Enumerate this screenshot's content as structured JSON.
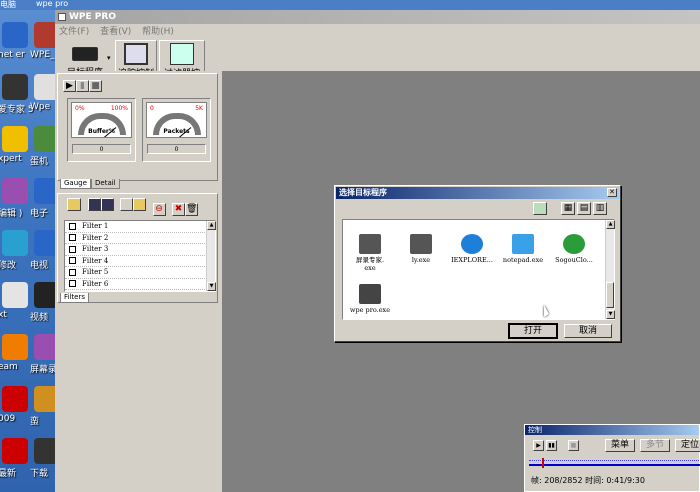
{
  "desktop": {
    "top_labels": [
      "电脑",
      "wpe pro"
    ],
    "icons": [
      {
        "label": "net er",
        "color": "#2a66c8"
      },
      {
        "label": "WPE_PI",
        "color": "#b03a2e"
      },
      {
        "label": "爱专家 5",
        "color": "#333"
      },
      {
        "label": "Wpe",
        "color": "#e0e0e0"
      },
      {
        "label": "xpert",
        "color": "#f0c000"
      },
      {
        "label": "蛋机",
        "color": "#4b8b3b"
      },
      {
        "label": "编辑 )",
        "color": "#9a4fb0"
      },
      {
        "label": "电子",
        "color": "#2a66c8"
      },
      {
        "label": "修改",
        "color": "#2aa0d0"
      },
      {
        "label": "电视",
        "color": "#2a66c8"
      },
      {
        "label": "xt",
        "color": "#e4e4e4"
      },
      {
        "label": "视频",
        "color": "#222"
      },
      {
        "label": "eam",
        "color": "#f07d00"
      },
      {
        "label": "屏幕录 V7.5注",
        "color": "#9a4fb0"
      },
      {
        "label": "009",
        "color": "#c00"
      },
      {
        "label": "蛮",
        "color": "#d09020"
      },
      {
        "label": "最新",
        "color": "#c00"
      },
      {
        "label": "下载",
        "color": "#333"
      }
    ]
  },
  "app": {
    "title": "WPE PRO",
    "menu": [
      "文件(F)",
      "查看(V)",
      "帮助(H)"
    ],
    "toolbar": {
      "target_label": "目标程序",
      "trace_label": "追踪控制",
      "filter_label": "过滤器控制"
    },
    "gauges": [
      {
        "name": "Buffer%",
        "min": "0%",
        "max": "100%",
        "value": "0"
      },
      {
        "name": "Packets",
        "min": "0",
        "max": "5K",
        "value": "0"
      }
    ],
    "gauge_tabs": [
      "Gauge",
      "Detail"
    ],
    "filters": [
      "Filter 1",
      "Filter 2",
      "Filter 3",
      "Filter 4",
      "Filter 5",
      "Filter 6"
    ],
    "filters_tab": "Filters"
  },
  "dialog": {
    "title": "选择目标程序",
    "files": [
      {
        "name": "屏录专家.\nexe",
        "icon": "projector-icon"
      },
      {
        "name": "ly.exe",
        "icon": "projector-icon"
      },
      {
        "name": "IEXPLORE...",
        "icon": "ie-icon"
      },
      {
        "name": "notepad.exe",
        "icon": "notepad-icon"
      },
      {
        "name": "SogouClo...",
        "icon": "sogou-icon"
      },
      {
        "name": "wpe pro.exe",
        "icon": "wpe-icon"
      }
    ],
    "open_label": "打开",
    "cancel_label": "取消"
  },
  "control": {
    "title": "控制",
    "menu_label": "菜单",
    "more_label": "多节",
    "locate_label": "定位",
    "status": "帧: 208/2852 时间: 0:41/9:30",
    "progress": 0.073
  },
  "colors": {
    "dialog_title": "#0a246a",
    "client_bg": "#808080",
    "face": "#d4d0c8"
  }
}
